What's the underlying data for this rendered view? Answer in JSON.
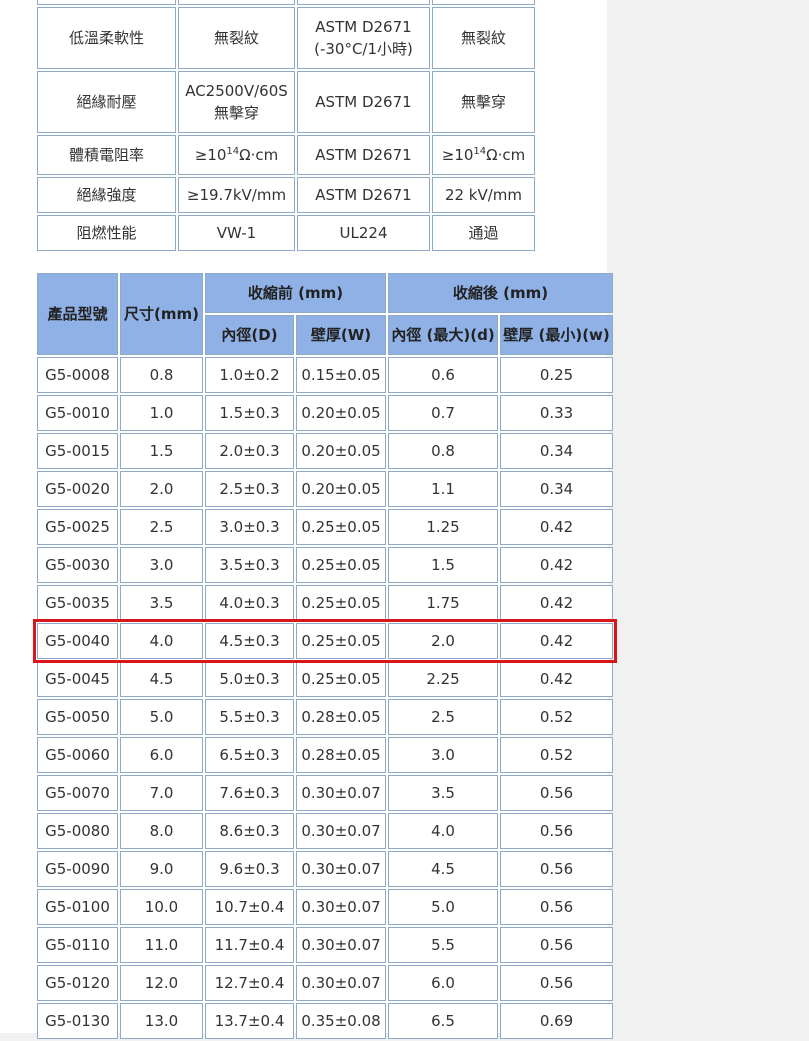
{
  "properties_table": {
    "rows": [
      {
        "property": "",
        "spec": "",
        "method": "",
        "result": ""
      },
      {
        "property": "低溫柔軟性",
        "spec": "無裂紋",
        "method": "ASTM D2671\n(-30°C/1小時)",
        "result": "無裂紋"
      },
      {
        "property": "絕緣耐壓",
        "spec": "AC2500V/60S\n無擊穿",
        "method": "ASTM D2671",
        "result": "無擊穿"
      },
      {
        "property": "體積電阻率",
        "spec_base": "≥10",
        "spec_exp": "14",
        "spec_unit": "Ω·cm",
        "method": "ASTM D2671",
        "result_base": "≥10",
        "result_exp": "14",
        "result_unit": "Ω·cm"
      },
      {
        "property": "絕緣強度",
        "spec": "≥19.7kV/mm",
        "method": "ASTM D2671",
        "result": "22 kV/mm"
      },
      {
        "property": "阻燃性能",
        "spec": "VW-1",
        "method": "UL224",
        "result": "通過"
      }
    ]
  },
  "spec_table": {
    "headers": {
      "model": "產品型號",
      "size": "尺寸(mm)",
      "before_group": "收縮前 (mm)",
      "after_group": "收縮後 (mm)",
      "inner_d": "內徑(D)",
      "wall_w": "壁厚(W)",
      "inner_max": "內徑 (最大)(d)",
      "wall_min": "壁厚 (最小)(w)"
    },
    "rows": [
      [
        "G5-0008",
        "0.8",
        "1.0±0.2",
        "0.15±0.05",
        "0.6",
        "0.25"
      ],
      [
        "G5-0010",
        "1.0",
        "1.5±0.3",
        "0.20±0.05",
        "0.7",
        "0.33"
      ],
      [
        "G5-0015",
        "1.5",
        "2.0±0.3",
        "0.20±0.05",
        "0.8",
        "0.34"
      ],
      [
        "G5-0020",
        "2.0",
        "2.5±0.3",
        "0.20±0.05",
        "1.1",
        "0.34"
      ],
      [
        "G5-0025",
        "2.5",
        "3.0±0.3",
        "0.25±0.05",
        "1.25",
        "0.42"
      ],
      [
        "G5-0030",
        "3.0",
        "3.5±0.3",
        "0.25±0.05",
        "1.5",
        "0.42"
      ],
      [
        "G5-0035",
        "3.5",
        "4.0±0.3",
        "0.25±0.05",
        "1.75",
        "0.42"
      ],
      [
        "G5-0040",
        "4.0",
        "4.5±0.3",
        "0.25±0.05",
        "2.0",
        "0.42"
      ],
      [
        "G5-0045",
        "4.5",
        "5.0±0.3",
        "0.25±0.05",
        "2.25",
        "0.42"
      ],
      [
        "G5-0050",
        "5.0",
        "5.5±0.3",
        "0.28±0.05",
        "2.5",
        "0.52"
      ],
      [
        "G5-0060",
        "6.0",
        "6.5±0.3",
        "0.28±0.05",
        "3.0",
        "0.52"
      ],
      [
        "G5-0070",
        "7.0",
        "7.6±0.3",
        "0.30±0.07",
        "3.5",
        "0.56"
      ],
      [
        "G5-0080",
        "8.0",
        "8.6±0.3",
        "0.30±0.07",
        "4.0",
        "0.56"
      ],
      [
        "G5-0090",
        "9.0",
        "9.6±0.3",
        "0.30±0.07",
        "4.5",
        "0.56"
      ],
      [
        "G5-0100",
        "10.0",
        "10.7±0.4",
        "0.30±0.07",
        "5.0",
        "0.56"
      ],
      [
        "G5-0110",
        "11.0",
        "11.7±0.4",
        "0.30±0.07",
        "5.5",
        "0.56"
      ],
      [
        "G5-0120",
        "12.0",
        "12.7±0.4",
        "0.30±0.07",
        "6.0",
        "0.56"
      ],
      [
        "G5-0130",
        "13.0",
        "13.7±0.4",
        "0.35±0.08",
        "6.5",
        "0.69"
      ]
    ],
    "highlighted_row": 7
  },
  "colors": {
    "header_bg": "#8fb1e6",
    "border": "#8fa9c9",
    "highlight": "#d9161c",
    "page_bg": "#f1f1f1"
  }
}
